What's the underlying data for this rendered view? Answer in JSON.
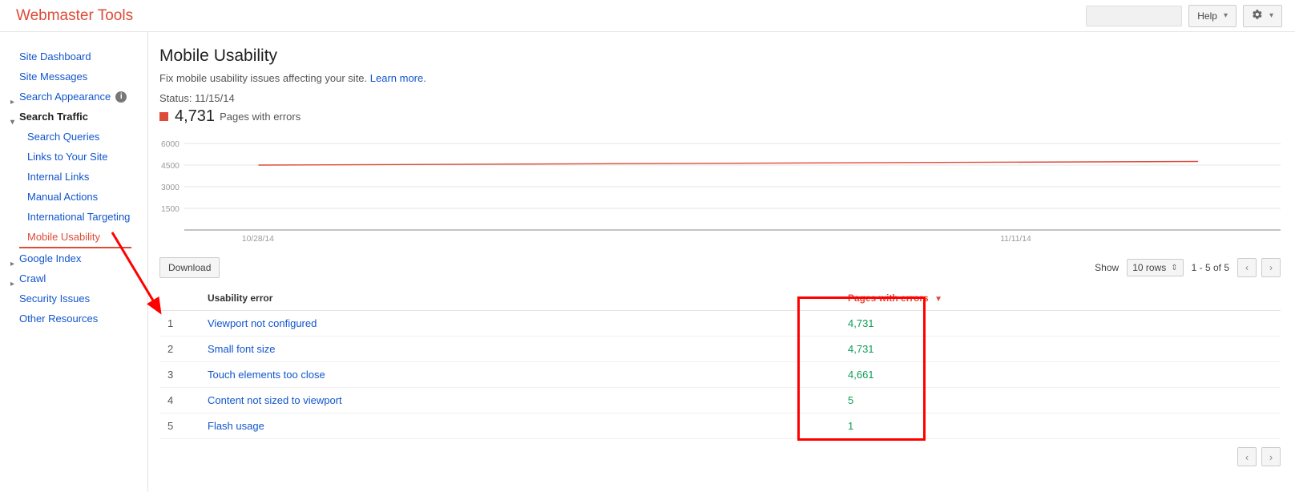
{
  "brand": "Webmaster Tools",
  "topbar": {
    "help_label": "Help"
  },
  "sidebar": {
    "items": [
      {
        "label": "Site Dashboard",
        "kind": "plain"
      },
      {
        "label": "Site Messages",
        "kind": "plain"
      },
      {
        "label": "Search Appearance",
        "kind": "collapsed",
        "info": true
      },
      {
        "label": "Search Traffic",
        "kind": "expanded",
        "children": [
          {
            "label": "Search Queries"
          },
          {
            "label": "Links to Your Site"
          },
          {
            "label": "Internal Links"
          },
          {
            "label": "Manual Actions"
          },
          {
            "label": "International Targeting"
          },
          {
            "label": "Mobile Usability",
            "active": true
          }
        ]
      },
      {
        "label": "Google Index",
        "kind": "collapsed"
      },
      {
        "label": "Crawl",
        "kind": "collapsed"
      },
      {
        "label": "Security Issues",
        "kind": "plain"
      },
      {
        "label": "Other Resources",
        "kind": "plain"
      }
    ]
  },
  "page": {
    "title": "Mobile Usability",
    "subtitle_pre": "Fix mobile usability issues affecting your site. ",
    "learn_more": "Learn more",
    "subtitle_post": ".",
    "status_label": "Status: ",
    "status_date": "11/15/14",
    "metric_value": "4,731",
    "metric_caption": "Pages with errors",
    "download_label": "Download",
    "show_label": "Show",
    "rows_label": "10 rows",
    "range_label": "1 - 5 of 5"
  },
  "chart_data": {
    "type": "line",
    "x": [
      "10/28/14",
      "11/11/14"
    ],
    "series": [
      {
        "name": "Pages with errors",
        "values": [
          4500,
          4750
        ]
      }
    ],
    "ylabel": "",
    "xlabel": "",
    "ylim": [
      0,
      6000
    ],
    "yticks": [
      1500,
      3000,
      4500,
      6000
    ],
    "xticks": [
      "10/28/14",
      "11/11/14"
    ]
  },
  "table": {
    "columns": {
      "index": "",
      "error": "Usability error",
      "pages": "Pages with errors"
    },
    "rows": [
      {
        "index": "1",
        "error": "Viewport not configured",
        "pages": "4,731"
      },
      {
        "index": "2",
        "error": "Small font size",
        "pages": "4,731"
      },
      {
        "index": "3",
        "error": "Touch elements too close",
        "pages": "4,661"
      },
      {
        "index": "4",
        "error": "Content not sized to viewport",
        "pages": "5"
      },
      {
        "index": "5",
        "error": "Flash usage",
        "pages": "1"
      }
    ]
  }
}
